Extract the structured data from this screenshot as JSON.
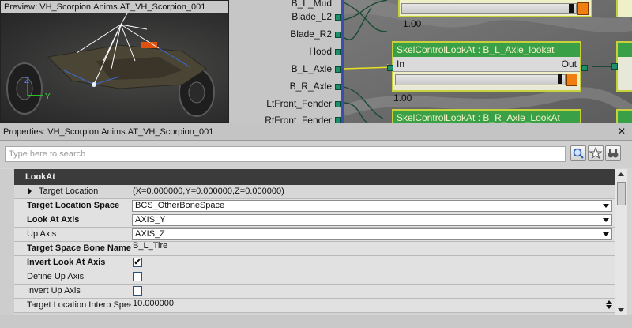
{
  "preview": {
    "title": "Preview: VH_Scorpion.Anims.AT_VH_Scorpion_001",
    "axis_z": "Z",
    "axis_y": "Y"
  },
  "graph": {
    "pins": [
      "Blade_L2",
      "Blade_R2",
      "Hood",
      "B_L_Axle",
      "B_R_Axle",
      "LtFront_Fender",
      "RtFront_Fender"
    ],
    "top_value": "1.00",
    "node1": {
      "title": "SkelControlLookAt : B_L_Axle_lookat",
      "in": "In",
      "out": "Out",
      "value": "1.00"
    },
    "node2": {
      "title": "SkelControlLookAt : B_R_Axle_LookAt"
    }
  },
  "properties": {
    "title": "Properties: VH_Scorpion.Anims.AT_VH_Scorpion_001",
    "search_placeholder": "Type here to search",
    "group": "LookAt",
    "rows": [
      {
        "name": "Target Location",
        "value": "(X=0.000000,Y=0.000000,Z=0.000000)"
      },
      {
        "name": "Target Location Space",
        "value": "BCS_OtherBoneSpace"
      },
      {
        "name": "Look At Axis",
        "value": "AXIS_Y"
      },
      {
        "name": "Up Axis",
        "value": "AXIS_Z"
      },
      {
        "name": "Target Space Bone Name",
        "value": "B_L_Tire"
      },
      {
        "name": "Invert Look At Axis",
        "value": "✔"
      },
      {
        "name": "Define Up Axis",
        "value": ""
      },
      {
        "name": "Invert Up Axis",
        "value": ""
      },
      {
        "name": "Target Location Interp Speed",
        "value": "10.000000"
      }
    ]
  },
  "colors": {
    "node_header": "#3aa048",
    "node_border": "#c7d23a",
    "slider_orange": "#f07f10",
    "group_bar": "#3b3b3b",
    "pin_green": "#1f8f6a"
  }
}
